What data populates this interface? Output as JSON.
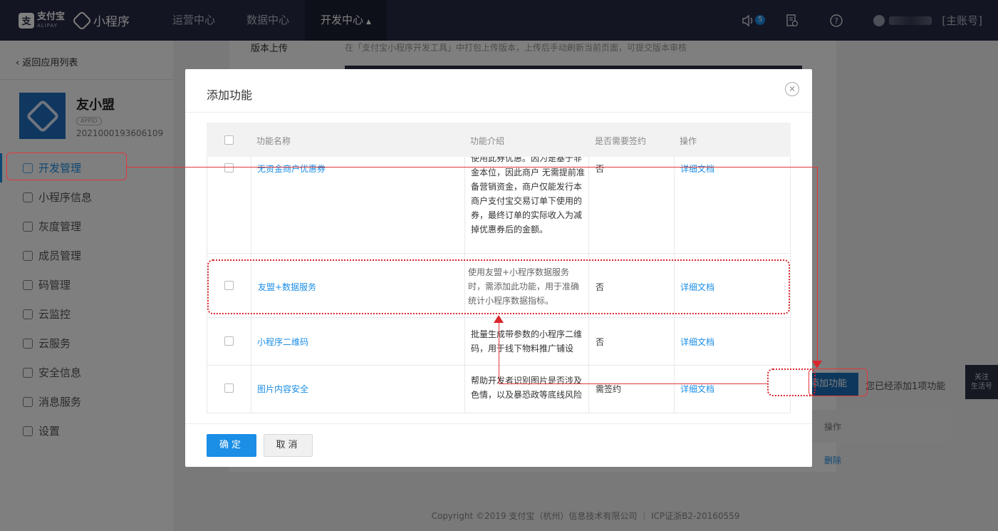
{
  "topbar": {
    "alipay_logo": "支",
    "alipay_cn": "支付宝",
    "alipay_en": "ALIPAY",
    "product_name": "小程序",
    "nav": [
      "运营中心",
      "数据中心",
      "开发中心"
    ],
    "nav_active_caret": "▲",
    "notification_count": "5",
    "account_label": "[主账号]"
  },
  "sidebar": {
    "back_link": "‹ 返回应用列表",
    "app_name": "友小盟",
    "app_tag": "APPID",
    "app_id": "2021000193606109",
    "items": [
      {
        "label": "开发管理",
        "icon": "code-icon"
      },
      {
        "label": "小程序信息",
        "icon": "grid-icon"
      },
      {
        "label": "灰度管理",
        "icon": "signal-icon"
      },
      {
        "label": "成员管理",
        "icon": "user-icon"
      },
      {
        "label": "码管理",
        "icon": "qrcode-icon"
      },
      {
        "label": "云监控",
        "icon": "cloud-icon"
      },
      {
        "label": "云服务",
        "icon": "cloud-icon"
      },
      {
        "label": "安全信息",
        "icon": "shield-icon"
      },
      {
        "label": "消息服务",
        "icon": "message-icon"
      },
      {
        "label": "设置",
        "icon": "gear-icon"
      }
    ]
  },
  "background": {
    "version_label": "版本上传",
    "version_desc": "在「支付宝小程序开发工具」中打包上传版本，上传后手动刷新当前页面，可提交版本审核",
    "add_button": "添加功能",
    "added_text": "您已经添加1项功能",
    "op_label": "操作",
    "delete_link": "删除",
    "follow_box": "关注\n生活号",
    "footer": "Copyright ©2019 支付宝（杭州）信息技术有限公司 ｜ ICP证浙B2-20160559"
  },
  "modal": {
    "title": "添加功能",
    "close_icon": "close-icon",
    "headers": [
      "功能名称",
      "功能介绍",
      "是否需要签约",
      "操作"
    ],
    "rows": [
      {
        "name": "无资金商户优惠券",
        "desc": "使用此券优惠。因为是基于非金本位，因此商户 无需提前准备营销资金，商户仅能发行本商户支付宝交易订单下使用的券，最终订单的实际收入为减掉优惠券后的金额。",
        "sign": "否",
        "doc": "详细文档"
      },
      {
        "name": "友盟+数据服务",
        "desc": "使用友盟+小程序数据服务时，需添加此功能，用于准确统计小程序数据指标。",
        "sign": "否",
        "doc": "详细文档"
      },
      {
        "name": "小程序二维码",
        "desc": "批量生成带参数的小程序二维码，用于线下物料推广铺设",
        "sign": "否",
        "doc": "详细文档"
      },
      {
        "name": "图片内容安全",
        "desc": "帮助开发者识别图片是否涉及色情，以及暴恐政等底线风险",
        "sign": "需签约",
        "doc": "详细文档"
      }
    ],
    "ok_button": "确定",
    "cancel_button": "取消"
  },
  "colors": {
    "topbar": "#262b45",
    "accent": "#1b8ee6",
    "annotation": "#d8262b"
  }
}
